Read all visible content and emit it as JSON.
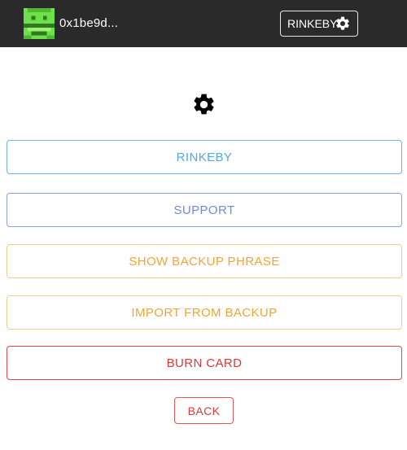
{
  "header": {
    "account_address": "0x1be9d...",
    "avatar_icon": "pixel-identicon",
    "network_button_label": "RINKEBY",
    "network_button_icon": "gear-icon"
  },
  "settings": {
    "icon": "gear-icon",
    "buttons": [
      {
        "label": "RINKEBY",
        "color": "#55a8dc"
      },
      {
        "label": "SUPPORT",
        "color": "#6f8ad6"
      },
      {
        "label": "SHOW BACKUP PHRASE",
        "color": "#f0a43a"
      },
      {
        "label": "IMPORT FROM BACKUP",
        "color": "#f0a43a"
      },
      {
        "label": "BURN CARD",
        "color": "#d83a3a"
      }
    ],
    "back_label": "BACK"
  },
  "colors": {
    "topbar": "#2a2a2a",
    "identicon_green": "#6ee04a",
    "identicon_dark": "#2f7a1e"
  }
}
